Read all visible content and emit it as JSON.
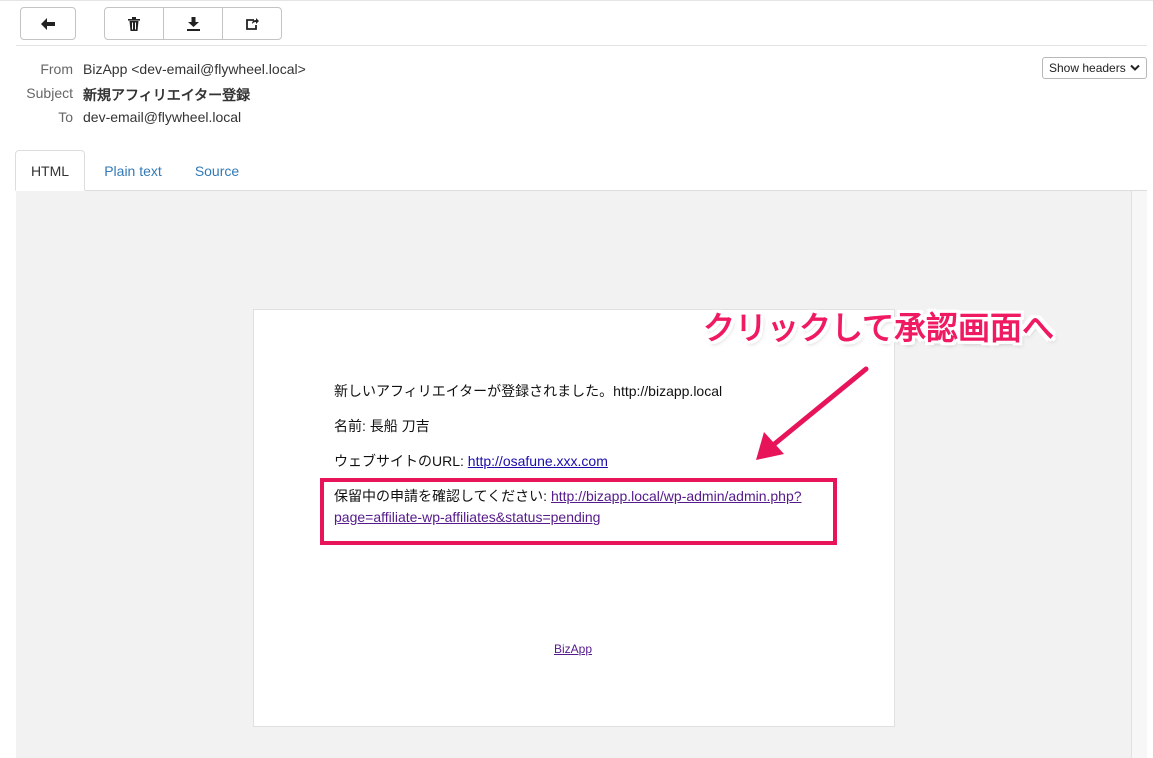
{
  "toolbar": {
    "back_icon": "arrow-left-icon",
    "delete_icon": "trash-icon",
    "download_icon": "download-icon",
    "forward_icon": "share-icon"
  },
  "headers": {
    "from_label": "From",
    "from_value": "BizApp <dev-email@flywheel.local>",
    "subject_label": "Subject",
    "subject_value": "新規アフィリエイター登録",
    "to_label": "To",
    "to_value": "dev-email@flywheel.local",
    "show_headers": "Show headers"
  },
  "tabs": [
    {
      "label": "HTML",
      "active": true
    },
    {
      "label": "Plain text",
      "active": false
    },
    {
      "label": "Source",
      "active": false
    }
  ],
  "email": {
    "line1": "新しいアフィリエイターが登録されました。http://bizapp.local",
    "line2": "名前: 長船 刀吉",
    "line3_prefix": "ウェブサイトのURL: ",
    "line3_link": "http://osafune.xxx.com",
    "line4_prefix": "保留中の申請を確認してください: ",
    "line4_link_a": "http://bizapp.local/wp-admin/admin.php?",
    "line4_link_b": "page=affiliate-wp-affiliates&status=pending",
    "footer_link": "BizApp"
  },
  "annotation": {
    "callout": "クリックして承認画面へ",
    "color": "#e8145a"
  }
}
